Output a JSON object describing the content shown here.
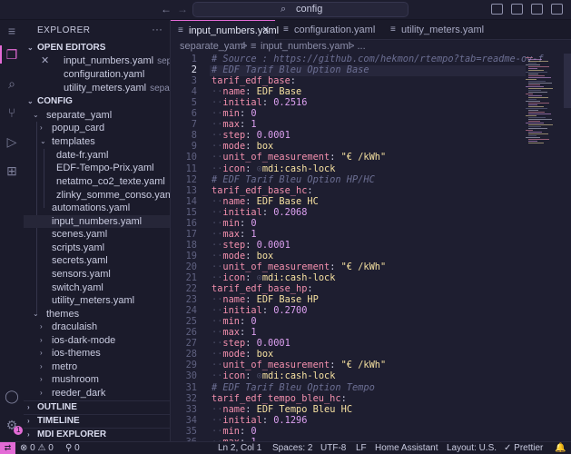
{
  "titlebar": {
    "search_text": "config",
    "search_icon": "search-icon"
  },
  "sidebar": {
    "title": "EXPLORER",
    "open_editors_label": "OPEN EDITORS",
    "open_editors": [
      {
        "name": "input_numbers.yaml",
        "desc": "sep..."
      },
      {
        "name": "configuration.yaml",
        "desc": ""
      },
      {
        "name": "utility_meters.yaml",
        "desc": "separ..."
      }
    ],
    "config_label": "CONFIG",
    "tree": [
      {
        "name": "separate_yaml",
        "folder": true
      },
      {
        "name": "popup_card",
        "folder": true
      },
      {
        "name": "templates",
        "folder": true
      },
      {
        "name": "date-fr.yaml"
      },
      {
        "name": "EDF-Tempo-Prix.yaml"
      },
      {
        "name": "netatmo_co2_texte.yaml"
      },
      {
        "name": "zlinky_somme_conso.yaml"
      },
      {
        "name": "automations.yaml"
      },
      {
        "name": "input_numbers.yaml"
      },
      {
        "name": "scenes.yaml"
      },
      {
        "name": "scripts.yaml"
      },
      {
        "name": "secrets.yaml"
      },
      {
        "name": "sensors.yaml"
      },
      {
        "name": "switch.yaml"
      },
      {
        "name": "utility_meters.yaml"
      },
      {
        "name": "themes",
        "folder": true
      },
      {
        "name": "draculaish",
        "folder": true
      },
      {
        "name": "ios-dark-mode",
        "folder": true
      },
      {
        "name": "ios-themes",
        "folder": true
      },
      {
        "name": "metro",
        "folder": true
      },
      {
        "name": "mushroom",
        "folder": true
      },
      {
        "name": "reeder_dark",
        "folder": true
      }
    ],
    "outline_label": "OUTLINE",
    "timeline_label": "TIMELINE",
    "mdi_label": "MDI EXPLORER"
  },
  "tabs": [
    {
      "label": "input_numbers.yaml",
      "active": true
    },
    {
      "label": "configuration.yaml",
      "active": false
    },
    {
      "label": "utility_meters.yaml",
      "active": false
    }
  ],
  "breadcrumb": {
    "folder": "separate_yaml",
    "sep": ">",
    "file": "input_numbers.yaml",
    "tail": "> ..."
  },
  "code_lines": [
    {
      "n": "1",
      "parts": [
        [
          "c",
          "# Source : https://github.com/hekmon/rtempo?tab=readme-ov-f"
        ]
      ]
    },
    {
      "n": "2",
      "parts": [
        [
          "c",
          "# EDF Tarif Bleu Option Base"
        ]
      ]
    },
    {
      "n": "3",
      "parts": [
        [
          "k",
          "tarif_edf_base"
        ],
        [
          "p",
          ":"
        ]
      ]
    },
    {
      "n": "4",
      "parts": [
        [
          "ws",
          "··"
        ],
        [
          "k",
          "name"
        ],
        [
          "p",
          ": "
        ],
        [
          "s",
          "EDF Base"
        ]
      ]
    },
    {
      "n": "5",
      "parts": [
        [
          "ws",
          "··"
        ],
        [
          "k",
          "initial"
        ],
        [
          "p",
          ": "
        ],
        [
          "n",
          "0.2516"
        ]
      ]
    },
    {
      "n": "6",
      "parts": [
        [
          "ws",
          "··"
        ],
        [
          "k",
          "min"
        ],
        [
          "p",
          ": "
        ],
        [
          "n",
          "0"
        ]
      ]
    },
    {
      "n": "7",
      "parts": [
        [
          "ws",
          "··"
        ],
        [
          "k",
          "max"
        ],
        [
          "p",
          ": "
        ],
        [
          "n",
          "1"
        ]
      ]
    },
    {
      "n": "8",
      "parts": [
        [
          "ws",
          "··"
        ],
        [
          "k",
          "step"
        ],
        [
          "p",
          ": "
        ],
        [
          "n",
          "0.0001"
        ]
      ]
    },
    {
      "n": "9",
      "parts": [
        [
          "ws",
          "··"
        ],
        [
          "k",
          "mode"
        ],
        [
          "p",
          ": "
        ],
        [
          "s",
          "box"
        ]
      ]
    },
    {
      "n": "10",
      "parts": [
        [
          "ws",
          "··"
        ],
        [
          "k",
          "unit_of_measurement"
        ],
        [
          "p",
          ": "
        ],
        [
          "s",
          "\"€ /kWh\""
        ]
      ]
    },
    {
      "n": "11",
      "parts": [
        [
          "ws",
          "··"
        ],
        [
          "k",
          "icon"
        ],
        [
          "p",
          ": "
        ],
        [
          "ws",
          "⊙"
        ],
        [
          "s",
          "mdi:cash-lock"
        ]
      ]
    },
    {
      "n": "12",
      "parts": [
        [
          "c",
          "# EDF Tarif Bleu Option HP/HC"
        ]
      ]
    },
    {
      "n": "13",
      "parts": [
        [
          "k",
          "tarif_edf_base_hc"
        ],
        [
          "p",
          ":"
        ]
      ]
    },
    {
      "n": "14",
      "parts": [
        [
          "ws",
          "··"
        ],
        [
          "k",
          "name"
        ],
        [
          "p",
          ": "
        ],
        [
          "s",
          "EDF Base HC"
        ]
      ]
    },
    {
      "n": "15",
      "parts": [
        [
          "ws",
          "··"
        ],
        [
          "k",
          "initial"
        ],
        [
          "p",
          ": "
        ],
        [
          "n",
          "0.2068"
        ]
      ]
    },
    {
      "n": "16",
      "parts": [
        [
          "ws",
          "··"
        ],
        [
          "k",
          "min"
        ],
        [
          "p",
          ": "
        ],
        [
          "n",
          "0"
        ]
      ]
    },
    {
      "n": "17",
      "parts": [
        [
          "ws",
          "··"
        ],
        [
          "k",
          "max"
        ],
        [
          "p",
          ": "
        ],
        [
          "n",
          "1"
        ]
      ]
    },
    {
      "n": "18",
      "parts": [
        [
          "ws",
          "··"
        ],
        [
          "k",
          "step"
        ],
        [
          "p",
          ": "
        ],
        [
          "n",
          "0.0001"
        ]
      ]
    },
    {
      "n": "19",
      "parts": [
        [
          "ws",
          "··"
        ],
        [
          "k",
          "mode"
        ],
        [
          "p",
          ": "
        ],
        [
          "s",
          "box"
        ]
      ]
    },
    {
      "n": "20",
      "parts": [
        [
          "ws",
          "··"
        ],
        [
          "k",
          "unit_of_measurement"
        ],
        [
          "p",
          ": "
        ],
        [
          "s",
          "\"€ /kWh\""
        ]
      ]
    },
    {
      "n": "21",
      "parts": [
        [
          "ws",
          "··"
        ],
        [
          "k",
          "icon"
        ],
        [
          "p",
          ": "
        ],
        [
          "ws",
          "⊙"
        ],
        [
          "s",
          "mdi:cash-lock"
        ]
      ]
    },
    {
      "n": "22",
      "parts": [
        [
          "k",
          "tarif_edf_base_hp"
        ],
        [
          "p",
          ":"
        ]
      ]
    },
    {
      "n": "23",
      "parts": [
        [
          "ws",
          "··"
        ],
        [
          "k",
          "name"
        ],
        [
          "p",
          ": "
        ],
        [
          "s",
          "EDF Base HP"
        ]
      ]
    },
    {
      "n": "24",
      "parts": [
        [
          "ws",
          "··"
        ],
        [
          "k",
          "initial"
        ],
        [
          "p",
          ": "
        ],
        [
          "n",
          "0.2700"
        ]
      ]
    },
    {
      "n": "25",
      "parts": [
        [
          "ws",
          "··"
        ],
        [
          "k",
          "min"
        ],
        [
          "p",
          ": "
        ],
        [
          "n",
          "0"
        ]
      ]
    },
    {
      "n": "26",
      "parts": [
        [
          "ws",
          "··"
        ],
        [
          "k",
          "max"
        ],
        [
          "p",
          ": "
        ],
        [
          "n",
          "1"
        ]
      ]
    },
    {
      "n": "27",
      "parts": [
        [
          "ws",
          "··"
        ],
        [
          "k",
          "step"
        ],
        [
          "p",
          ": "
        ],
        [
          "n",
          "0.0001"
        ]
      ]
    },
    {
      "n": "28",
      "parts": [
        [
          "ws",
          "··"
        ],
        [
          "k",
          "mode"
        ],
        [
          "p",
          ": "
        ],
        [
          "s",
          "box"
        ]
      ]
    },
    {
      "n": "29",
      "parts": [
        [
          "ws",
          "··"
        ],
        [
          "k",
          "unit_of_measurement"
        ],
        [
          "p",
          ": "
        ],
        [
          "s",
          "\"€ /kWh\""
        ]
      ]
    },
    {
      "n": "30",
      "parts": [
        [
          "ws",
          "··"
        ],
        [
          "k",
          "icon"
        ],
        [
          "p",
          ": "
        ],
        [
          "ws",
          "⊙"
        ],
        [
          "s",
          "mdi:cash-lock"
        ]
      ]
    },
    {
      "n": "31",
      "parts": [
        [
          "c",
          "# EDF Tarif Bleu Option Tempo"
        ]
      ]
    },
    {
      "n": "32",
      "parts": [
        [
          "k",
          "tarif_edf_tempo_bleu_hc"
        ],
        [
          "p",
          ":"
        ]
      ]
    },
    {
      "n": "33",
      "parts": [
        [
          "ws",
          "··"
        ],
        [
          "k",
          "name"
        ],
        [
          "p",
          ": "
        ],
        [
          "s",
          "EDF Tempo Bleu HC"
        ]
      ]
    },
    {
      "n": "34",
      "parts": [
        [
          "ws",
          "··"
        ],
        [
          "k",
          "initial"
        ],
        [
          "p",
          ": "
        ],
        [
          "n",
          "0.1296"
        ]
      ]
    },
    {
      "n": "35",
      "parts": [
        [
          "ws",
          "··"
        ],
        [
          "k",
          "min"
        ],
        [
          "p",
          ": "
        ],
        [
          "n",
          "0"
        ]
      ]
    },
    {
      "n": "36",
      "parts": [
        [
          "ws",
          "··"
        ],
        [
          "k",
          "max"
        ],
        [
          "p",
          ": "
        ],
        [
          "n",
          "1"
        ]
      ]
    }
  ],
  "statusbar": {
    "problems": "⊗ 0 ⚠ 0",
    "ports": "⚲ 0",
    "position": "Ln 2, Col 1",
    "spaces": "Spaces: 2",
    "encoding": "UTF-8",
    "eol": "LF",
    "home_assistant": "Home Assistant",
    "layout": "Layout: U.S.",
    "prettier": "✓ Prettier",
    "bell": "🔔"
  },
  "colors": {
    "accent": "#e36bd6",
    "bg": "#1b1b2b",
    "editor_bg": "#1e1e30"
  }
}
